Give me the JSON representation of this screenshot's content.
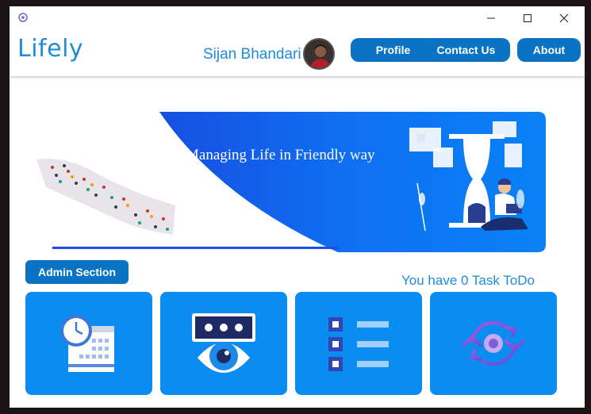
{
  "app": {
    "logo_text": "Lifely"
  },
  "window_controls": {
    "minimize_glyph": "—",
    "maximize_glyph": "☐",
    "close_glyph": "✕"
  },
  "header": {
    "username": "Sijan Bhandari",
    "nav": [
      {
        "label": "Profile"
      },
      {
        "label": "Contact Us"
      },
      {
        "label": "About"
      }
    ]
  },
  "banner": {
    "tagline": "Managing Life in Friendly way"
  },
  "admin": {
    "label": "Admin Section"
  },
  "tasks": {
    "summary": "You have 0 Task ToDo"
  },
  "cards": [
    {
      "icon": "calendar-clock-icon"
    },
    {
      "icon": "eye-view-icon"
    },
    {
      "icon": "checklist-icon"
    },
    {
      "icon": "sync-icon"
    }
  ],
  "colors": {
    "accent": "#0a73c4",
    "brand_text": "#1f8cd8",
    "card": "#0a8cf0",
    "banner_blue": "#1a5fea"
  }
}
